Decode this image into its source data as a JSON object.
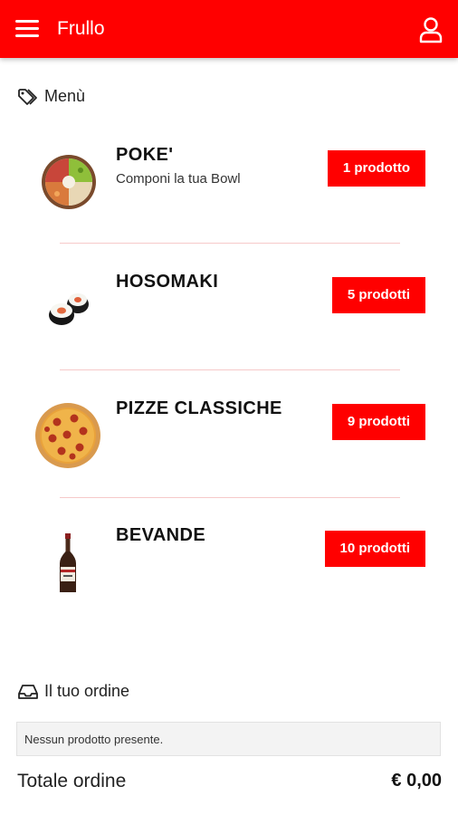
{
  "header": {
    "title": "Frullo",
    "menu_icon": "hamburger-icon",
    "user_icon": "user-icon",
    "bg_color": "#ff0000"
  },
  "menu_section": {
    "label": "Menù",
    "icon": "tag-icon"
  },
  "categories": [
    {
      "title": "POKE'",
      "subtitle": "Componi la tua Bowl",
      "count_label": "1 prodotto",
      "image": "poke-bowl-image"
    },
    {
      "title": "HOSOMAKI",
      "subtitle": "",
      "count_label": "5 prodotti",
      "image": "hosomaki-image"
    },
    {
      "title": "PIZZE CLASSICHE",
      "subtitle": "",
      "count_label": "9 prodotti",
      "image": "pizza-image"
    },
    {
      "title": "BEVANDE",
      "subtitle": "",
      "count_label": "10 prodotti",
      "image": "bottle-image"
    }
  ],
  "order_section": {
    "label": "Il tuo ordine",
    "icon": "tray-icon",
    "empty_message": "Nessun prodotto presente.",
    "total_label": "Totale ordine",
    "total_value": "€ 0,00"
  }
}
